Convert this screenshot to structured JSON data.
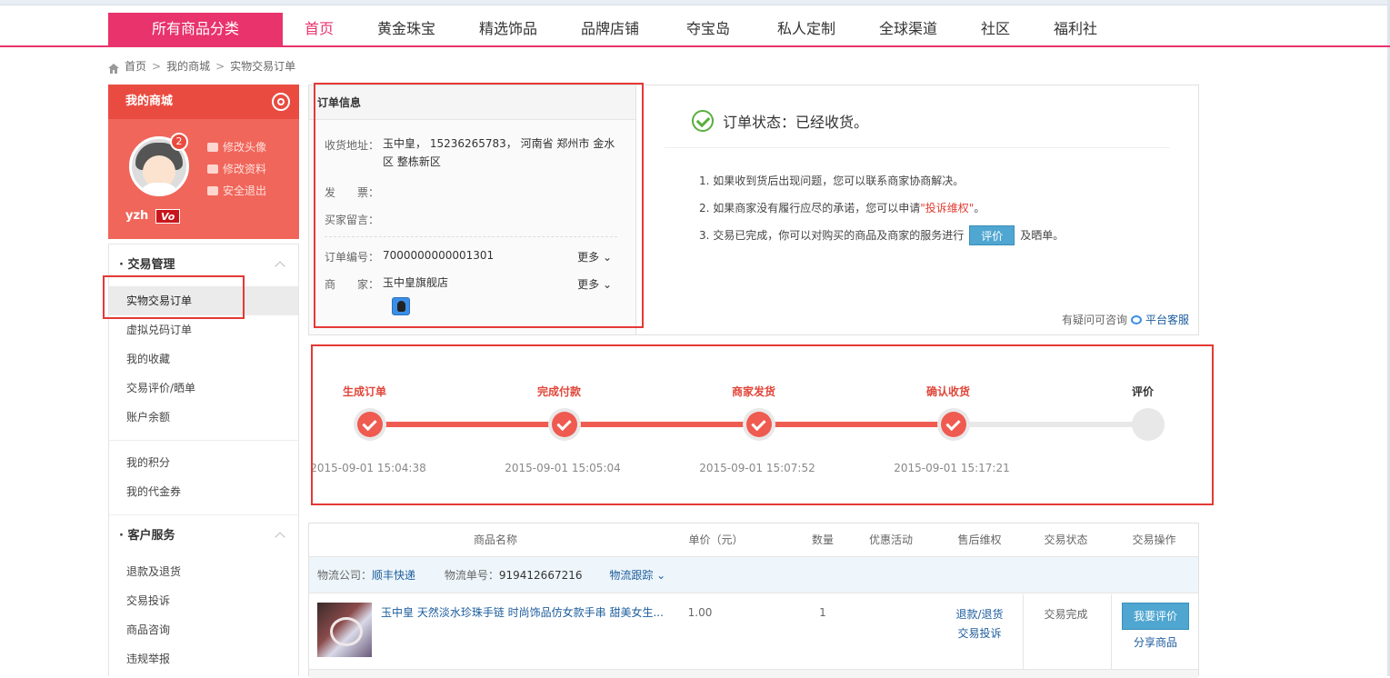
{
  "nav": {
    "all_categories": "所有商品分类",
    "items": [
      "首页",
      "黄金珠宝",
      "精选饰品",
      "品牌店铺",
      "夺宝岛",
      "私人定制",
      "全球渠道",
      "社区",
      "福利社"
    ]
  },
  "breadcrumb": [
    "首页",
    "我的商城",
    "实物交易订单"
  ],
  "profile": {
    "title": "我的商城",
    "badge_count": "2",
    "links": [
      "修改头像",
      "修改资料",
      "安全退出"
    ],
    "username": "yzh",
    "vip_badge": "Vo"
  },
  "sidebar": {
    "sections": [
      {
        "title": "· 交易管理",
        "items": [
          "实物交易订单",
          "虚拟兑码订单",
          "我的收藏",
          "交易评价/晒单",
          "账户余额"
        ]
      },
      {
        "items": [
          "我的积分",
          "我的代金券"
        ]
      },
      {
        "title": "· 客户服务",
        "items": [
          "退款及退货",
          "交易投诉",
          "商品咨询",
          "违规举报"
        ]
      }
    ]
  },
  "order_info": {
    "header": "订单信息",
    "address_label": "收货地址：",
    "address": "玉中皇， 15236265783， 河南省 郑州市 金水区 整栋新区",
    "invoice_label": "发　　票：",
    "invoice": "",
    "message_label": "买家留言：",
    "message": "",
    "order_no_label": "订单编号：",
    "order_no": "7000000000001301",
    "merchant_label": "商　　家：",
    "merchant": "玉中皇旗舰店",
    "more": "更多"
  },
  "status": {
    "title": "订单状态：已经收货。",
    "tip1": "1. 如果收到货后出现问题，您可以联系商家协商解决。",
    "tip2_pre": "2. 如果商家没有履行应尽的承诺，您可以申请",
    "tip2_link": "\"投诉维权\"",
    "tip2_post": "。",
    "tip3_pre": "3. 交易已完成，你可以对购买的商品及商家的服务进行",
    "tip3_btn": "评价",
    "tip3_post": "及晒单。",
    "consult_text": "有疑问可咨询",
    "consult_link": "平台客服"
  },
  "steps": [
    {
      "label": "生成订单",
      "time": "2015-09-01 15:04:38",
      "done": true
    },
    {
      "label": "完成付款",
      "time": "2015-09-01 15:05:04",
      "done": true
    },
    {
      "label": "商家发货",
      "time": "2015-09-01 15:07:52",
      "done": true
    },
    {
      "label": "确认收货",
      "time": "2015-09-01 15:17:21",
      "done": true
    },
    {
      "label": "评价",
      "time": "",
      "done": false
    }
  ],
  "table": {
    "headers": [
      "商品名称",
      "单价（元）",
      "数量",
      "优惠活动",
      "售后维权",
      "交易状态",
      "交易操作"
    ],
    "logistics_label": "物流公司：",
    "logistics_company": "顺丰快递",
    "tracking_label": "物流单号：",
    "tracking_no": "919412667216",
    "tracking_link": "物流跟踪",
    "product": {
      "name": "玉中皇 天然淡水珍珠手链 时尚饰品仿女款手串 甜美女生...",
      "price": "1.00",
      "qty": "1",
      "aftersale1": "退款/退货",
      "aftersale2": "交易投诉",
      "status": "交易完成",
      "rate_btn": "我要评价",
      "share": "分享商品"
    }
  },
  "colors": {
    "brand": "#e8336d",
    "accent_red": "#ef5b50",
    "link_blue": "#1c5c9c",
    "button_blue": "#4fa6d1"
  }
}
